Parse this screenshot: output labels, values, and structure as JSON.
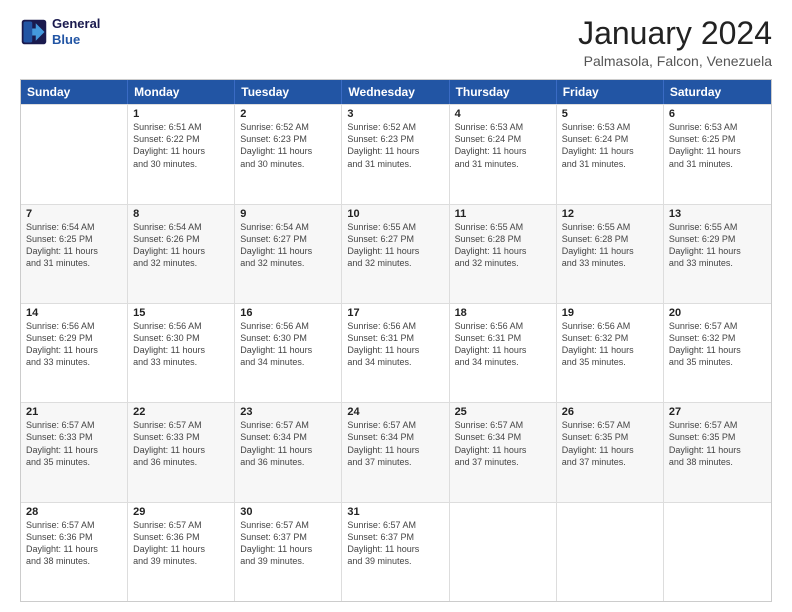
{
  "logo": {
    "line1": "General",
    "line2": "Blue"
  },
  "title": "January 2024",
  "location": "Palmasola, Falcon, Venezuela",
  "weekdays": [
    "Sunday",
    "Monday",
    "Tuesday",
    "Wednesday",
    "Thursday",
    "Friday",
    "Saturday"
  ],
  "rows": [
    [
      {
        "day": "",
        "lines": []
      },
      {
        "day": "1",
        "lines": [
          "Sunrise: 6:51 AM",
          "Sunset: 6:22 PM",
          "Daylight: 11 hours",
          "and 30 minutes."
        ]
      },
      {
        "day": "2",
        "lines": [
          "Sunrise: 6:52 AM",
          "Sunset: 6:23 PM",
          "Daylight: 11 hours",
          "and 30 minutes."
        ]
      },
      {
        "day": "3",
        "lines": [
          "Sunrise: 6:52 AM",
          "Sunset: 6:23 PM",
          "Daylight: 11 hours",
          "and 31 minutes."
        ]
      },
      {
        "day": "4",
        "lines": [
          "Sunrise: 6:53 AM",
          "Sunset: 6:24 PM",
          "Daylight: 11 hours",
          "and 31 minutes."
        ]
      },
      {
        "day": "5",
        "lines": [
          "Sunrise: 6:53 AM",
          "Sunset: 6:24 PM",
          "Daylight: 11 hours",
          "and 31 minutes."
        ]
      },
      {
        "day": "6",
        "lines": [
          "Sunrise: 6:53 AM",
          "Sunset: 6:25 PM",
          "Daylight: 11 hours",
          "and 31 minutes."
        ]
      }
    ],
    [
      {
        "day": "7",
        "lines": [
          "Sunrise: 6:54 AM",
          "Sunset: 6:25 PM",
          "Daylight: 11 hours",
          "and 31 minutes."
        ]
      },
      {
        "day": "8",
        "lines": [
          "Sunrise: 6:54 AM",
          "Sunset: 6:26 PM",
          "Daylight: 11 hours",
          "and 32 minutes."
        ]
      },
      {
        "day": "9",
        "lines": [
          "Sunrise: 6:54 AM",
          "Sunset: 6:27 PM",
          "Daylight: 11 hours",
          "and 32 minutes."
        ]
      },
      {
        "day": "10",
        "lines": [
          "Sunrise: 6:55 AM",
          "Sunset: 6:27 PM",
          "Daylight: 11 hours",
          "and 32 minutes."
        ]
      },
      {
        "day": "11",
        "lines": [
          "Sunrise: 6:55 AM",
          "Sunset: 6:28 PM",
          "Daylight: 11 hours",
          "and 32 minutes."
        ]
      },
      {
        "day": "12",
        "lines": [
          "Sunrise: 6:55 AM",
          "Sunset: 6:28 PM",
          "Daylight: 11 hours",
          "and 33 minutes."
        ]
      },
      {
        "day": "13",
        "lines": [
          "Sunrise: 6:55 AM",
          "Sunset: 6:29 PM",
          "Daylight: 11 hours",
          "and 33 minutes."
        ]
      }
    ],
    [
      {
        "day": "14",
        "lines": [
          "Sunrise: 6:56 AM",
          "Sunset: 6:29 PM",
          "Daylight: 11 hours",
          "and 33 minutes."
        ]
      },
      {
        "day": "15",
        "lines": [
          "Sunrise: 6:56 AM",
          "Sunset: 6:30 PM",
          "Daylight: 11 hours",
          "and 33 minutes."
        ]
      },
      {
        "day": "16",
        "lines": [
          "Sunrise: 6:56 AM",
          "Sunset: 6:30 PM",
          "Daylight: 11 hours",
          "and 34 minutes."
        ]
      },
      {
        "day": "17",
        "lines": [
          "Sunrise: 6:56 AM",
          "Sunset: 6:31 PM",
          "Daylight: 11 hours",
          "and 34 minutes."
        ]
      },
      {
        "day": "18",
        "lines": [
          "Sunrise: 6:56 AM",
          "Sunset: 6:31 PM",
          "Daylight: 11 hours",
          "and 34 minutes."
        ]
      },
      {
        "day": "19",
        "lines": [
          "Sunrise: 6:56 AM",
          "Sunset: 6:32 PM",
          "Daylight: 11 hours",
          "and 35 minutes."
        ]
      },
      {
        "day": "20",
        "lines": [
          "Sunrise: 6:57 AM",
          "Sunset: 6:32 PM",
          "Daylight: 11 hours",
          "and 35 minutes."
        ]
      }
    ],
    [
      {
        "day": "21",
        "lines": [
          "Sunrise: 6:57 AM",
          "Sunset: 6:33 PM",
          "Daylight: 11 hours",
          "and 35 minutes."
        ]
      },
      {
        "day": "22",
        "lines": [
          "Sunrise: 6:57 AM",
          "Sunset: 6:33 PM",
          "Daylight: 11 hours",
          "and 36 minutes."
        ]
      },
      {
        "day": "23",
        "lines": [
          "Sunrise: 6:57 AM",
          "Sunset: 6:34 PM",
          "Daylight: 11 hours",
          "and 36 minutes."
        ]
      },
      {
        "day": "24",
        "lines": [
          "Sunrise: 6:57 AM",
          "Sunset: 6:34 PM",
          "Daylight: 11 hours",
          "and 37 minutes."
        ]
      },
      {
        "day": "25",
        "lines": [
          "Sunrise: 6:57 AM",
          "Sunset: 6:34 PM",
          "Daylight: 11 hours",
          "and 37 minutes."
        ]
      },
      {
        "day": "26",
        "lines": [
          "Sunrise: 6:57 AM",
          "Sunset: 6:35 PM",
          "Daylight: 11 hours",
          "and 37 minutes."
        ]
      },
      {
        "day": "27",
        "lines": [
          "Sunrise: 6:57 AM",
          "Sunset: 6:35 PM",
          "Daylight: 11 hours",
          "and 38 minutes."
        ]
      }
    ],
    [
      {
        "day": "28",
        "lines": [
          "Sunrise: 6:57 AM",
          "Sunset: 6:36 PM",
          "Daylight: 11 hours",
          "and 38 minutes."
        ]
      },
      {
        "day": "29",
        "lines": [
          "Sunrise: 6:57 AM",
          "Sunset: 6:36 PM",
          "Daylight: 11 hours",
          "and 39 minutes."
        ]
      },
      {
        "day": "30",
        "lines": [
          "Sunrise: 6:57 AM",
          "Sunset: 6:37 PM",
          "Daylight: 11 hours",
          "and 39 minutes."
        ]
      },
      {
        "day": "31",
        "lines": [
          "Sunrise: 6:57 AM",
          "Sunset: 6:37 PM",
          "Daylight: 11 hours",
          "and 39 minutes."
        ]
      },
      {
        "day": "",
        "lines": []
      },
      {
        "day": "",
        "lines": []
      },
      {
        "day": "",
        "lines": []
      }
    ]
  ]
}
